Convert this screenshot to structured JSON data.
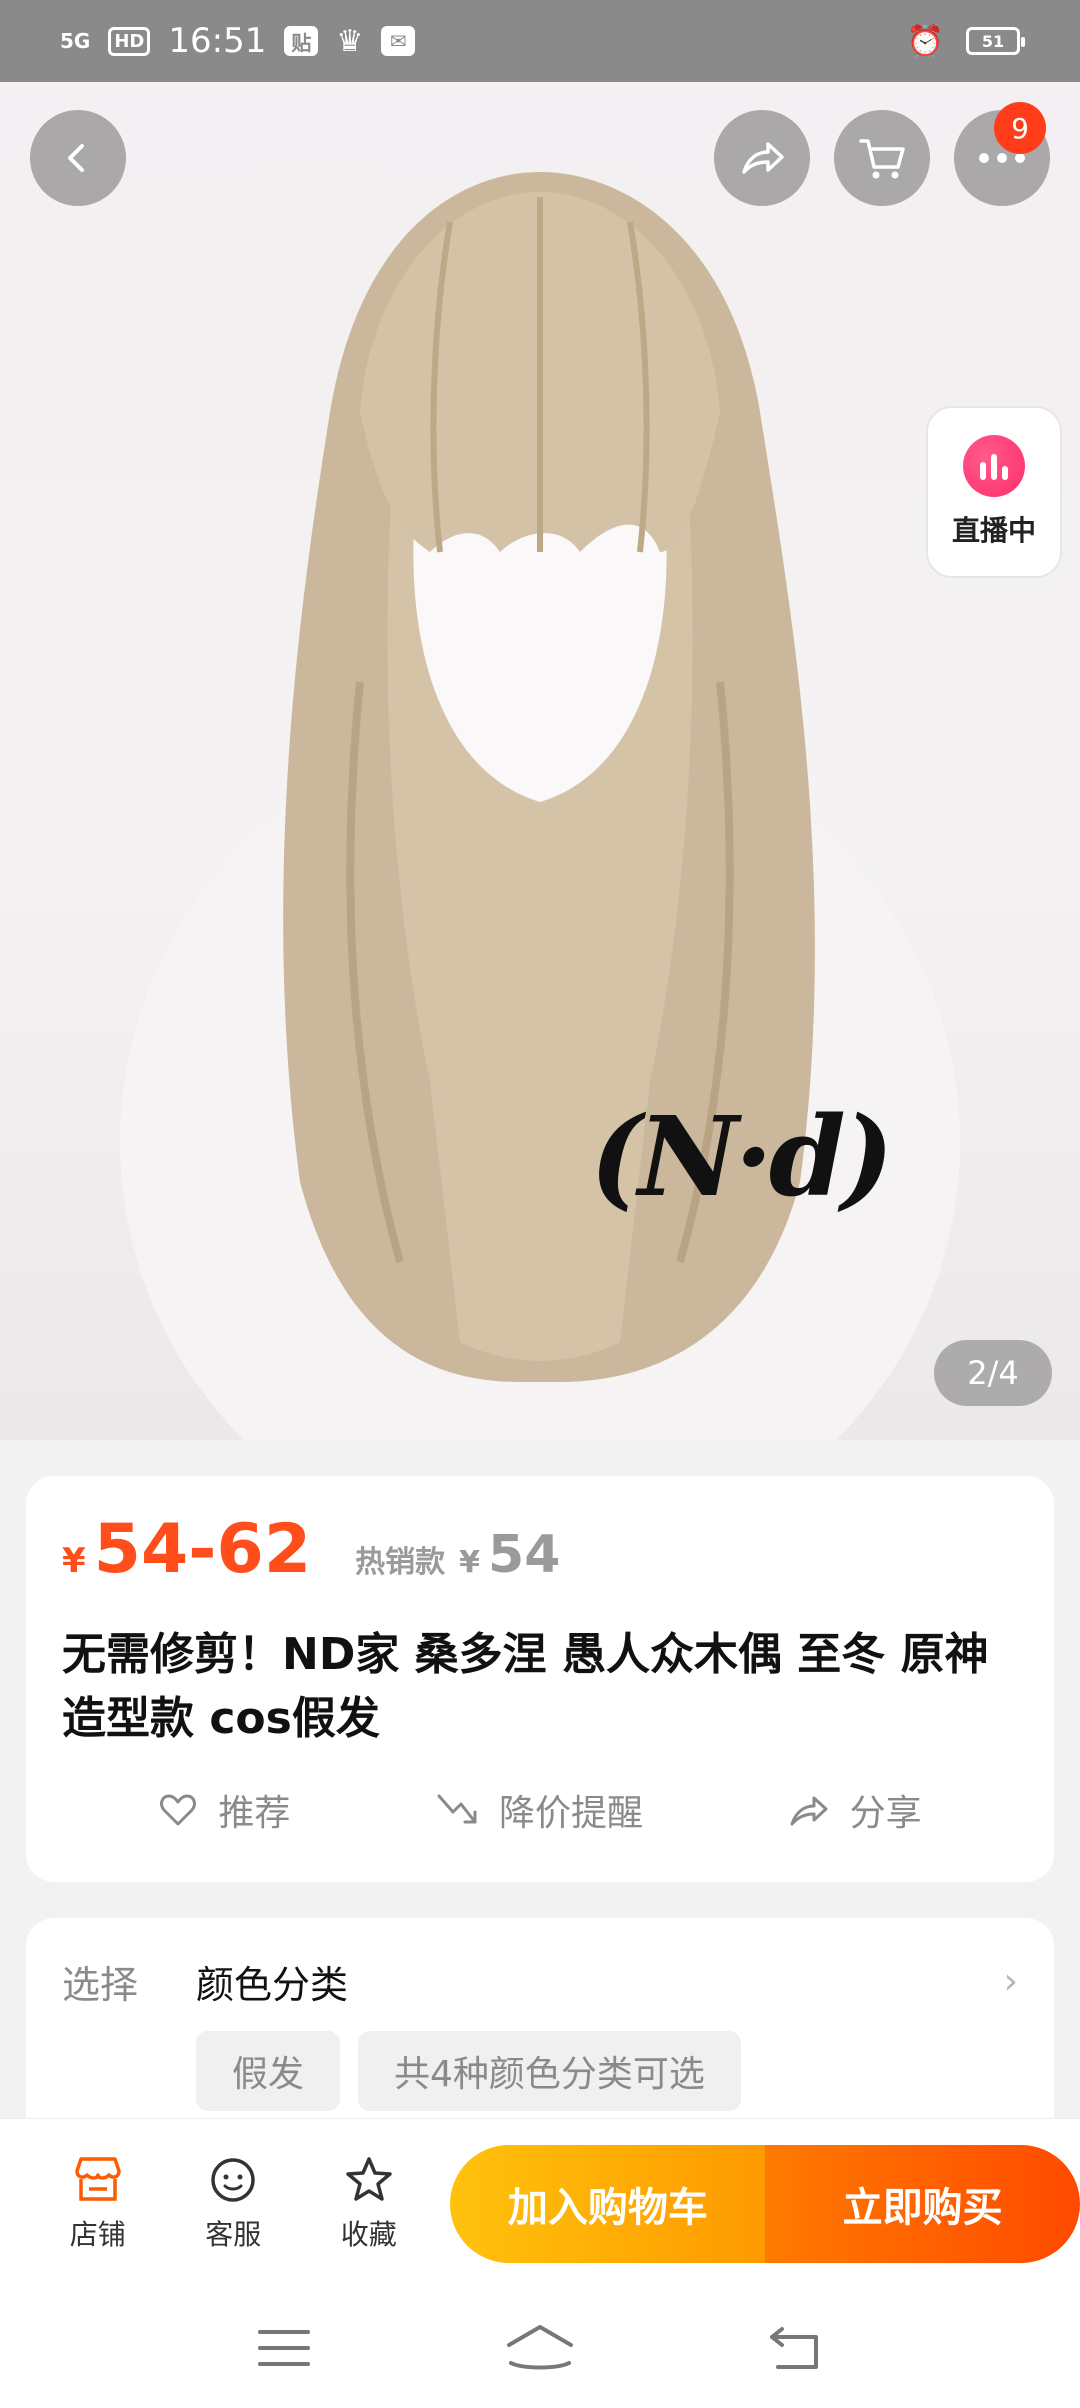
{
  "status_bar": {
    "network": "5G",
    "hd": "HD",
    "time": "16:51",
    "battery": "51"
  },
  "hero": {
    "cart_count": "9",
    "live_label": "直播中",
    "watermark": "(N·d)",
    "page_indicator": "2/4"
  },
  "price": {
    "currency": "¥",
    "range": "54-62",
    "hot_label": "热销款",
    "hot_price": "54"
  },
  "product": {
    "title": "无需修剪！ND家 桑多涅 愚人众木偶 至冬 原神 造型款 cos假发"
  },
  "actions": {
    "recommend": "推荐",
    "price_alert": "降价提醒",
    "share": "分享"
  },
  "options": {
    "label": "选择",
    "value": "颜色分类",
    "chip1": "假发",
    "chip2": "共4种颜色分类可选"
  },
  "bottom": {
    "store": "店铺",
    "service": "客服",
    "favorite": "收藏",
    "add_to_cart": "加入购物车",
    "buy_now": "立即购买"
  },
  "colors": {
    "accent": "#ff4d1c",
    "cart_gradient_start": "#ffc20c",
    "buy_gradient_end": "#ff4a00"
  }
}
